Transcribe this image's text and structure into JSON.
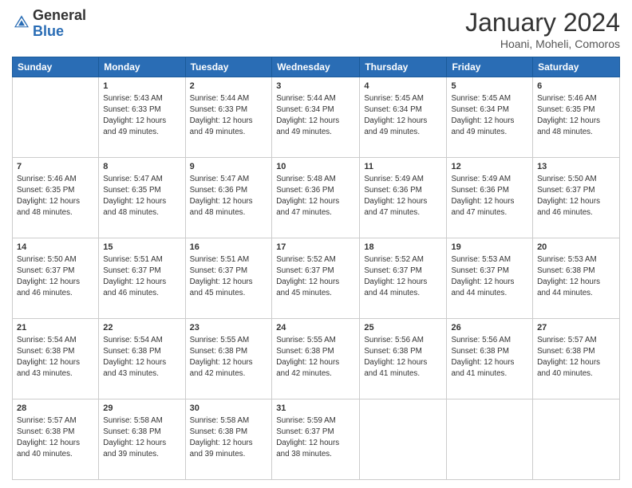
{
  "header": {
    "logo_general": "General",
    "logo_blue": "Blue",
    "month_year": "January 2024",
    "location": "Hoani, Moheli, Comoros"
  },
  "weekdays": [
    "Sunday",
    "Monday",
    "Tuesday",
    "Wednesday",
    "Thursday",
    "Friday",
    "Saturday"
  ],
  "weeks": [
    [
      {
        "day": "",
        "info": ""
      },
      {
        "day": "1",
        "info": "Sunrise: 5:43 AM\nSunset: 6:33 PM\nDaylight: 12 hours\nand 49 minutes."
      },
      {
        "day": "2",
        "info": "Sunrise: 5:44 AM\nSunset: 6:33 PM\nDaylight: 12 hours\nand 49 minutes."
      },
      {
        "day": "3",
        "info": "Sunrise: 5:44 AM\nSunset: 6:34 PM\nDaylight: 12 hours\nand 49 minutes."
      },
      {
        "day": "4",
        "info": "Sunrise: 5:45 AM\nSunset: 6:34 PM\nDaylight: 12 hours\nand 49 minutes."
      },
      {
        "day": "5",
        "info": "Sunrise: 5:45 AM\nSunset: 6:34 PM\nDaylight: 12 hours\nand 49 minutes."
      },
      {
        "day": "6",
        "info": "Sunrise: 5:46 AM\nSunset: 6:35 PM\nDaylight: 12 hours\nand 48 minutes."
      }
    ],
    [
      {
        "day": "7",
        "info": "Sunrise: 5:46 AM\nSunset: 6:35 PM\nDaylight: 12 hours\nand 48 minutes."
      },
      {
        "day": "8",
        "info": "Sunrise: 5:47 AM\nSunset: 6:35 PM\nDaylight: 12 hours\nand 48 minutes."
      },
      {
        "day": "9",
        "info": "Sunrise: 5:47 AM\nSunset: 6:36 PM\nDaylight: 12 hours\nand 48 minutes."
      },
      {
        "day": "10",
        "info": "Sunrise: 5:48 AM\nSunset: 6:36 PM\nDaylight: 12 hours\nand 47 minutes."
      },
      {
        "day": "11",
        "info": "Sunrise: 5:49 AM\nSunset: 6:36 PM\nDaylight: 12 hours\nand 47 minutes."
      },
      {
        "day": "12",
        "info": "Sunrise: 5:49 AM\nSunset: 6:36 PM\nDaylight: 12 hours\nand 47 minutes."
      },
      {
        "day": "13",
        "info": "Sunrise: 5:50 AM\nSunset: 6:37 PM\nDaylight: 12 hours\nand 46 minutes."
      }
    ],
    [
      {
        "day": "14",
        "info": "Sunrise: 5:50 AM\nSunset: 6:37 PM\nDaylight: 12 hours\nand 46 minutes."
      },
      {
        "day": "15",
        "info": "Sunrise: 5:51 AM\nSunset: 6:37 PM\nDaylight: 12 hours\nand 46 minutes."
      },
      {
        "day": "16",
        "info": "Sunrise: 5:51 AM\nSunset: 6:37 PM\nDaylight: 12 hours\nand 45 minutes."
      },
      {
        "day": "17",
        "info": "Sunrise: 5:52 AM\nSunset: 6:37 PM\nDaylight: 12 hours\nand 45 minutes."
      },
      {
        "day": "18",
        "info": "Sunrise: 5:52 AM\nSunset: 6:37 PM\nDaylight: 12 hours\nand 44 minutes."
      },
      {
        "day": "19",
        "info": "Sunrise: 5:53 AM\nSunset: 6:37 PM\nDaylight: 12 hours\nand 44 minutes."
      },
      {
        "day": "20",
        "info": "Sunrise: 5:53 AM\nSunset: 6:38 PM\nDaylight: 12 hours\nand 44 minutes."
      }
    ],
    [
      {
        "day": "21",
        "info": "Sunrise: 5:54 AM\nSunset: 6:38 PM\nDaylight: 12 hours\nand 43 minutes."
      },
      {
        "day": "22",
        "info": "Sunrise: 5:54 AM\nSunset: 6:38 PM\nDaylight: 12 hours\nand 43 minutes."
      },
      {
        "day": "23",
        "info": "Sunrise: 5:55 AM\nSunset: 6:38 PM\nDaylight: 12 hours\nand 42 minutes."
      },
      {
        "day": "24",
        "info": "Sunrise: 5:55 AM\nSunset: 6:38 PM\nDaylight: 12 hours\nand 42 minutes."
      },
      {
        "day": "25",
        "info": "Sunrise: 5:56 AM\nSunset: 6:38 PM\nDaylight: 12 hours\nand 41 minutes."
      },
      {
        "day": "26",
        "info": "Sunrise: 5:56 AM\nSunset: 6:38 PM\nDaylight: 12 hours\nand 41 minutes."
      },
      {
        "day": "27",
        "info": "Sunrise: 5:57 AM\nSunset: 6:38 PM\nDaylight: 12 hours\nand 40 minutes."
      }
    ],
    [
      {
        "day": "28",
        "info": "Sunrise: 5:57 AM\nSunset: 6:38 PM\nDaylight: 12 hours\nand 40 minutes."
      },
      {
        "day": "29",
        "info": "Sunrise: 5:58 AM\nSunset: 6:38 PM\nDaylight: 12 hours\nand 39 minutes."
      },
      {
        "day": "30",
        "info": "Sunrise: 5:58 AM\nSunset: 6:38 PM\nDaylight: 12 hours\nand 39 minutes."
      },
      {
        "day": "31",
        "info": "Sunrise: 5:59 AM\nSunset: 6:37 PM\nDaylight: 12 hours\nand 38 minutes."
      },
      {
        "day": "",
        "info": ""
      },
      {
        "day": "",
        "info": ""
      },
      {
        "day": "",
        "info": ""
      }
    ]
  ]
}
